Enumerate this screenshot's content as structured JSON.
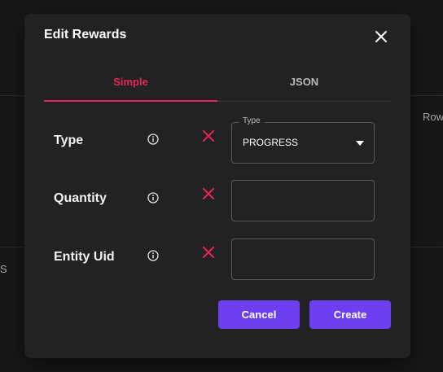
{
  "background": {
    "row_text": "Row",
    "s_text": "S"
  },
  "dialog": {
    "title": "Edit Rewards",
    "close_icon": "close-icon",
    "tabs": [
      {
        "label": "Simple",
        "active": true
      },
      {
        "label": "JSON",
        "active": false
      }
    ],
    "fields": [
      {
        "label": "Type",
        "legend": "Type",
        "value": "PROGRESS",
        "kind": "select"
      },
      {
        "label": "Quantity",
        "value": "",
        "placeholder": "",
        "kind": "text"
      },
      {
        "label": "Entity Uid",
        "value": "",
        "placeholder": "",
        "kind": "text"
      }
    ],
    "buttons": {
      "cancel_label": "Cancel",
      "create_label": "Create"
    }
  },
  "colors": {
    "accent": "#e8245a",
    "primary_button": "#6c3ff0",
    "dialog_bg": "#222224",
    "page_bg": "#171618"
  }
}
